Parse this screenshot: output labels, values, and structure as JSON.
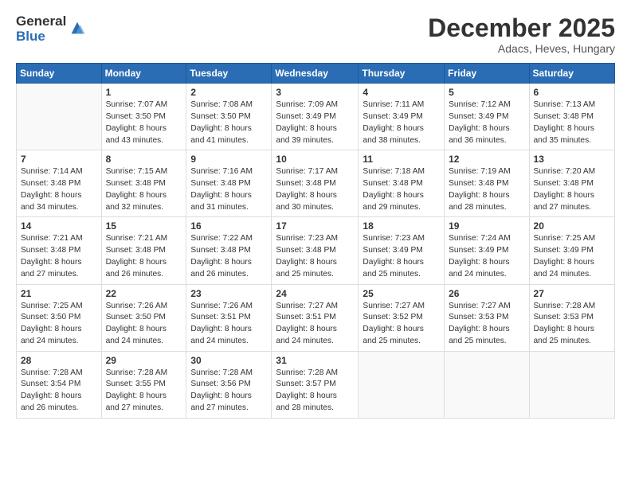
{
  "logo": {
    "general": "General",
    "blue": "Blue"
  },
  "header": {
    "month": "December 2025",
    "location": "Adacs, Heves, Hungary"
  },
  "weekdays": [
    "Sunday",
    "Monday",
    "Tuesday",
    "Wednesday",
    "Thursday",
    "Friday",
    "Saturday"
  ],
  "weeks": [
    [
      {
        "day": "",
        "sunrise": "",
        "sunset": "",
        "daylight": ""
      },
      {
        "day": "1",
        "sunrise": "Sunrise: 7:07 AM",
        "sunset": "Sunset: 3:50 PM",
        "daylight": "Daylight: 8 hours and 43 minutes."
      },
      {
        "day": "2",
        "sunrise": "Sunrise: 7:08 AM",
        "sunset": "Sunset: 3:50 PM",
        "daylight": "Daylight: 8 hours and 41 minutes."
      },
      {
        "day": "3",
        "sunrise": "Sunrise: 7:09 AM",
        "sunset": "Sunset: 3:49 PM",
        "daylight": "Daylight: 8 hours and 39 minutes."
      },
      {
        "day": "4",
        "sunrise": "Sunrise: 7:11 AM",
        "sunset": "Sunset: 3:49 PM",
        "daylight": "Daylight: 8 hours and 38 minutes."
      },
      {
        "day": "5",
        "sunrise": "Sunrise: 7:12 AM",
        "sunset": "Sunset: 3:49 PM",
        "daylight": "Daylight: 8 hours and 36 minutes."
      },
      {
        "day": "6",
        "sunrise": "Sunrise: 7:13 AM",
        "sunset": "Sunset: 3:48 PM",
        "daylight": "Daylight: 8 hours and 35 minutes."
      }
    ],
    [
      {
        "day": "7",
        "sunrise": "Sunrise: 7:14 AM",
        "sunset": "Sunset: 3:48 PM",
        "daylight": "Daylight: 8 hours and 34 minutes."
      },
      {
        "day": "8",
        "sunrise": "Sunrise: 7:15 AM",
        "sunset": "Sunset: 3:48 PM",
        "daylight": "Daylight: 8 hours and 32 minutes."
      },
      {
        "day": "9",
        "sunrise": "Sunrise: 7:16 AM",
        "sunset": "Sunset: 3:48 PM",
        "daylight": "Daylight: 8 hours and 31 minutes."
      },
      {
        "day": "10",
        "sunrise": "Sunrise: 7:17 AM",
        "sunset": "Sunset: 3:48 PM",
        "daylight": "Daylight: 8 hours and 30 minutes."
      },
      {
        "day": "11",
        "sunrise": "Sunrise: 7:18 AM",
        "sunset": "Sunset: 3:48 PM",
        "daylight": "Daylight: 8 hours and 29 minutes."
      },
      {
        "day": "12",
        "sunrise": "Sunrise: 7:19 AM",
        "sunset": "Sunset: 3:48 PM",
        "daylight": "Daylight: 8 hours and 28 minutes."
      },
      {
        "day": "13",
        "sunrise": "Sunrise: 7:20 AM",
        "sunset": "Sunset: 3:48 PM",
        "daylight": "Daylight: 8 hours and 27 minutes."
      }
    ],
    [
      {
        "day": "14",
        "sunrise": "Sunrise: 7:21 AM",
        "sunset": "Sunset: 3:48 PM",
        "daylight": "Daylight: 8 hours and 27 minutes."
      },
      {
        "day": "15",
        "sunrise": "Sunrise: 7:21 AM",
        "sunset": "Sunset: 3:48 PM",
        "daylight": "Daylight: 8 hours and 26 minutes."
      },
      {
        "day": "16",
        "sunrise": "Sunrise: 7:22 AM",
        "sunset": "Sunset: 3:48 PM",
        "daylight": "Daylight: 8 hours and 26 minutes."
      },
      {
        "day": "17",
        "sunrise": "Sunrise: 7:23 AM",
        "sunset": "Sunset: 3:48 PM",
        "daylight": "Daylight: 8 hours and 25 minutes."
      },
      {
        "day": "18",
        "sunrise": "Sunrise: 7:23 AM",
        "sunset": "Sunset: 3:49 PM",
        "daylight": "Daylight: 8 hours and 25 minutes."
      },
      {
        "day": "19",
        "sunrise": "Sunrise: 7:24 AM",
        "sunset": "Sunset: 3:49 PM",
        "daylight": "Daylight: 8 hours and 24 minutes."
      },
      {
        "day": "20",
        "sunrise": "Sunrise: 7:25 AM",
        "sunset": "Sunset: 3:49 PM",
        "daylight": "Daylight: 8 hours and 24 minutes."
      }
    ],
    [
      {
        "day": "21",
        "sunrise": "Sunrise: 7:25 AM",
        "sunset": "Sunset: 3:50 PM",
        "daylight": "Daylight: 8 hours and 24 minutes."
      },
      {
        "day": "22",
        "sunrise": "Sunrise: 7:26 AM",
        "sunset": "Sunset: 3:50 PM",
        "daylight": "Daylight: 8 hours and 24 minutes."
      },
      {
        "day": "23",
        "sunrise": "Sunrise: 7:26 AM",
        "sunset": "Sunset: 3:51 PM",
        "daylight": "Daylight: 8 hours and 24 minutes."
      },
      {
        "day": "24",
        "sunrise": "Sunrise: 7:27 AM",
        "sunset": "Sunset: 3:51 PM",
        "daylight": "Daylight: 8 hours and 24 minutes."
      },
      {
        "day": "25",
        "sunrise": "Sunrise: 7:27 AM",
        "sunset": "Sunset: 3:52 PM",
        "daylight": "Daylight: 8 hours and 25 minutes."
      },
      {
        "day": "26",
        "sunrise": "Sunrise: 7:27 AM",
        "sunset": "Sunset: 3:53 PM",
        "daylight": "Daylight: 8 hours and 25 minutes."
      },
      {
        "day": "27",
        "sunrise": "Sunrise: 7:28 AM",
        "sunset": "Sunset: 3:53 PM",
        "daylight": "Daylight: 8 hours and 25 minutes."
      }
    ],
    [
      {
        "day": "28",
        "sunrise": "Sunrise: 7:28 AM",
        "sunset": "Sunset: 3:54 PM",
        "daylight": "Daylight: 8 hours and 26 minutes."
      },
      {
        "day": "29",
        "sunrise": "Sunrise: 7:28 AM",
        "sunset": "Sunset: 3:55 PM",
        "daylight": "Daylight: 8 hours and 27 minutes."
      },
      {
        "day": "30",
        "sunrise": "Sunrise: 7:28 AM",
        "sunset": "Sunset: 3:56 PM",
        "daylight": "Daylight: 8 hours and 27 minutes."
      },
      {
        "day": "31",
        "sunrise": "Sunrise: 7:28 AM",
        "sunset": "Sunset: 3:57 PM",
        "daylight": "Daylight: 8 hours and 28 minutes."
      },
      {
        "day": "",
        "sunrise": "",
        "sunset": "",
        "daylight": ""
      },
      {
        "day": "",
        "sunrise": "",
        "sunset": "",
        "daylight": ""
      },
      {
        "day": "",
        "sunrise": "",
        "sunset": "",
        "daylight": ""
      }
    ]
  ]
}
